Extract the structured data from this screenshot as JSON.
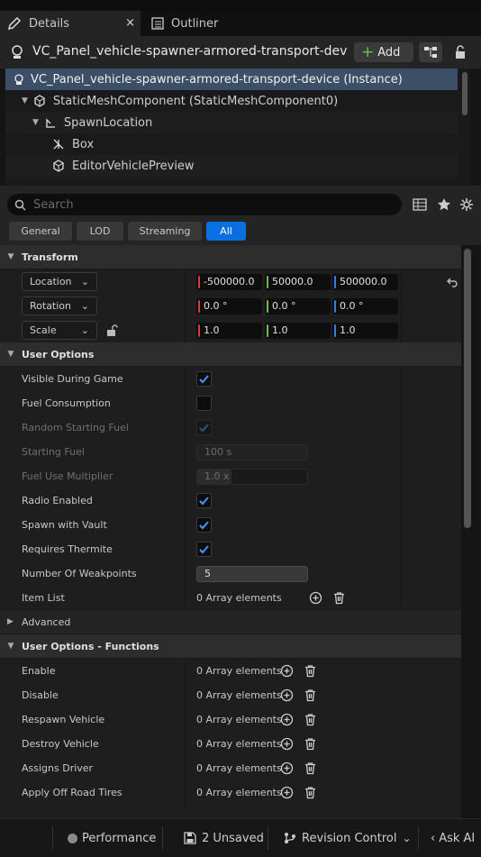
{
  "tabs": {
    "details": "Details",
    "outliner": "Outliner",
    "close": "×"
  },
  "header": {
    "title": "VC_Panel_vehicle-spawner-armored-transport-dev",
    "add_label": "Add",
    "add_icon": "+"
  },
  "tree": {
    "items": [
      {
        "label": "VC_Panel_vehicle-spawner-armored-transport-device (Instance)"
      },
      {
        "label": "StaticMeshComponent (StaticMeshComponent0)"
      },
      {
        "label": "SpawnLocation"
      },
      {
        "label": "Box"
      },
      {
        "label": "EditorVehiclePreview"
      }
    ]
  },
  "search": {
    "placeholder": "Search"
  },
  "filters": {
    "general": "General",
    "lod": "LOD",
    "streaming": "Streaming",
    "all": "All"
  },
  "transform": {
    "title": "Transform",
    "location": {
      "label": "Location",
      "x": "-500000.0",
      "y": "50000.0",
      "z": "500000.0"
    },
    "rotation": {
      "label": "Rotation",
      "x": "0.0 °",
      "y": "0.0 °",
      "z": "0.0 °"
    },
    "scale": {
      "label": "Scale",
      "x": "1.0",
      "y": "1.0",
      "z": "1.0"
    }
  },
  "user_options": {
    "title": "User Options",
    "visible_during_game": "Visible During Game",
    "fuel_consumption": "Fuel Consumption",
    "random_starting_fuel": "Random Starting Fuel",
    "starting_fuel": "Starting Fuel",
    "starting_fuel_value": "100 s",
    "fuel_use_multiplier": "Fuel Use Multiplier",
    "fuel_use_multiplier_value": "1.0 x",
    "radio_enabled": "Radio Enabled",
    "spawn_with_vault": "Spawn with Vault",
    "requires_thermite": "Requires Thermite",
    "number_of_weakpoints": "Number Of Weakpoints",
    "number_of_weakpoints_value": "5",
    "item_list": "Item List",
    "item_list_value": "0 Array elements"
  },
  "advanced": {
    "title": "Advanced"
  },
  "functions": {
    "title": "User Options - Functions",
    "array_value": "0 Array elements",
    "items": [
      "Enable",
      "Disable",
      "Respawn Vehicle",
      "Destroy Vehicle",
      "Assigns Driver",
      "Apply Off Road Tires"
    ]
  },
  "footer": {
    "performance": "Performance",
    "unsaved": "2 Unsaved",
    "revision_control": "Revision Control",
    "ask_ai": "Ask AI"
  },
  "colors": {
    "accent": "#0a6fe0",
    "x_axis": "#d83a3a",
    "y_axis": "#6cc04a",
    "z_axis": "#3a7fe0"
  }
}
